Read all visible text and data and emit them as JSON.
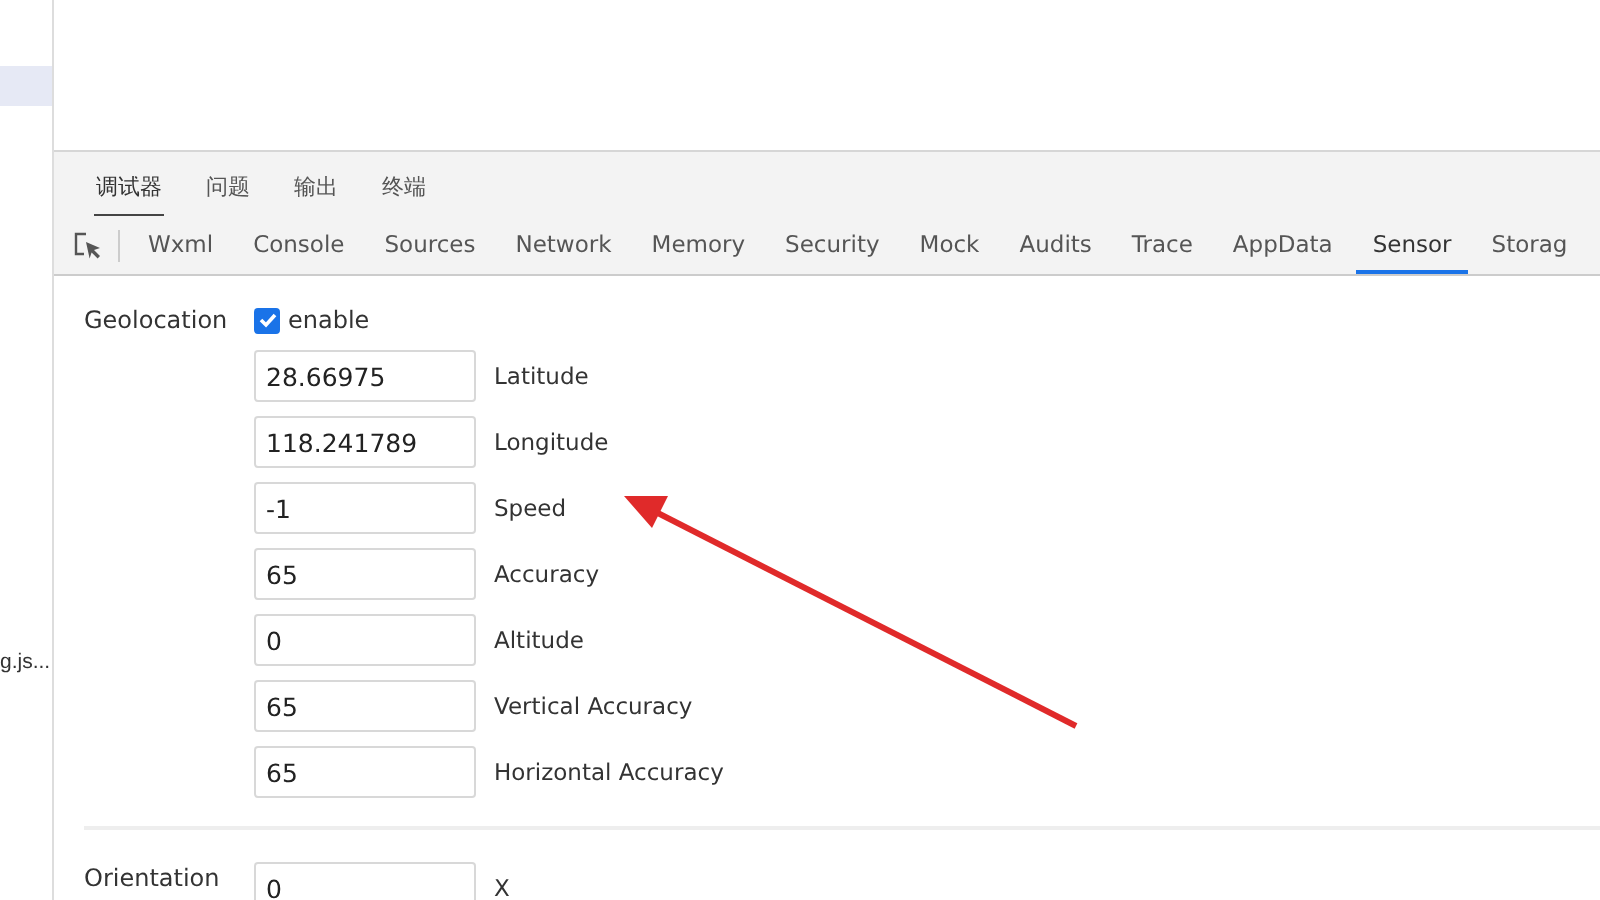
{
  "sidebar": {
    "items": [
      {
        "selected": true
      },
      {
        "label": "g.js...",
        "selected": false
      }
    ]
  },
  "panel_tabs": [
    {
      "label": "调试器",
      "selected": true
    },
    {
      "label": "问题",
      "selected": false
    },
    {
      "label": "输出",
      "selected": false
    },
    {
      "label": "终端",
      "selected": false
    }
  ],
  "devtools_tabs": [
    {
      "label": "Wxml",
      "selected": false
    },
    {
      "label": "Console",
      "selected": false
    },
    {
      "label": "Sources",
      "selected": false
    },
    {
      "label": "Network",
      "selected": false
    },
    {
      "label": "Memory",
      "selected": false
    },
    {
      "label": "Security",
      "selected": false
    },
    {
      "label": "Mock",
      "selected": false
    },
    {
      "label": "Audits",
      "selected": false
    },
    {
      "label": "Trace",
      "selected": false
    },
    {
      "label": "AppData",
      "selected": false
    },
    {
      "label": "Sensor",
      "selected": true
    },
    {
      "label": "Storag",
      "selected": false
    }
  ],
  "geolocation": {
    "title": "Geolocation",
    "enable": {
      "label": "enable",
      "checked": true
    },
    "fields": [
      {
        "value": "28.66975",
        "label": "Latitude"
      },
      {
        "value": "118.241789",
        "label": "Longitude"
      },
      {
        "value": "-1",
        "label": "Speed"
      },
      {
        "value": "65",
        "label": "Accuracy"
      },
      {
        "value": "0",
        "label": "Altitude"
      },
      {
        "value": "65",
        "label": "Vertical Accuracy"
      },
      {
        "value": "65",
        "label": "Horizontal Accuracy"
      }
    ]
  },
  "orientation": {
    "title": "Orientation",
    "fields": [
      {
        "value": "0",
        "label": "X"
      }
    ]
  }
}
